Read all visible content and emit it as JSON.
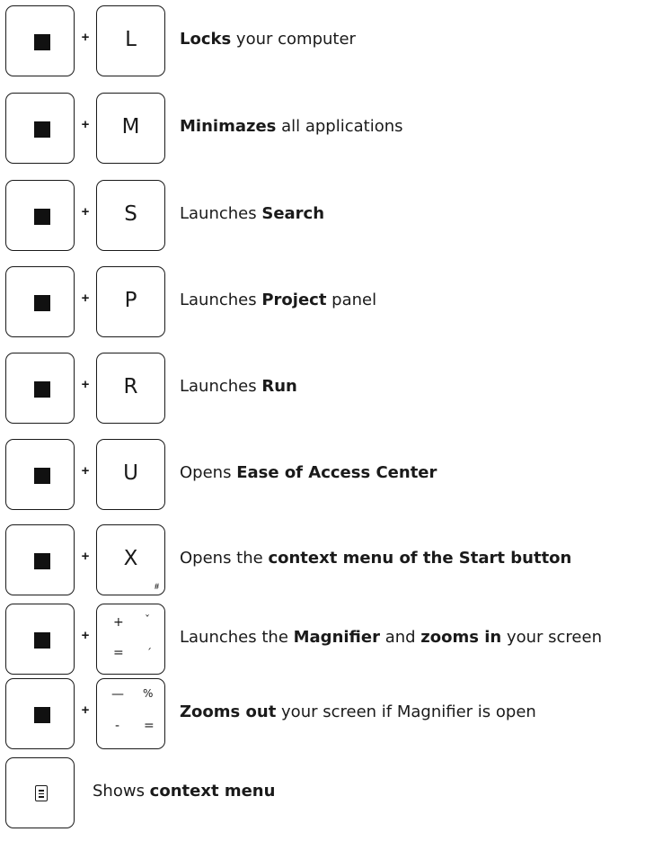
{
  "shortcuts": [
    {
      "modifier": "win-key",
      "plus": "+",
      "key": "L",
      "sub": "",
      "pre": "",
      "bold": "Locks",
      "mid": " your computer",
      "bold2": "",
      "post": ""
    },
    {
      "modifier": "win-key",
      "plus": "+",
      "key": "M",
      "sub": "",
      "pre": "",
      "bold": "Minimazes",
      "mid": " all applications",
      "bold2": "",
      "post": ""
    },
    {
      "modifier": "win-key",
      "plus": "+",
      "key": "S",
      "sub": "",
      "pre": "Launches ",
      "bold": "Search",
      "mid": "",
      "bold2": "",
      "post": ""
    },
    {
      "modifier": "win-key",
      "plus": "+",
      "key": "P",
      "sub": "",
      "pre": "Launches ",
      "bold": "Project",
      "mid": " panel",
      "bold2": "",
      "post": ""
    },
    {
      "modifier": "win-key",
      "plus": "+",
      "key": "R",
      "sub": "",
      "pre": "Launches ",
      "bold": "Run",
      "mid": "",
      "bold2": "",
      "post": ""
    },
    {
      "modifier": "win-key",
      "plus": "+",
      "key": "U",
      "sub": "",
      "pre": "Opens ",
      "bold": "Ease of Access Center",
      "mid": "",
      "bold2": "",
      "post": ""
    },
    {
      "modifier": "win-key",
      "plus": "+",
      "key": "X",
      "sub": "#",
      "pre": "Opens the ",
      "bold": "context menu of the Start button",
      "mid": "",
      "bold2": "",
      "post": ""
    },
    {
      "modifier": "win-key",
      "plus": "+",
      "key_glyphs": [
        "+",
        "ˇ",
        "=",
        "ˊ"
      ],
      "pre": "Launches the ",
      "bold": "Magnifier",
      "mid": " and ",
      "bold2": "zooms in",
      "post": " your screen"
    },
    {
      "modifier": "win-key",
      "plus": "+",
      "key_glyphs": [
        "—",
        "%",
        "-",
        "="
      ],
      "pre": "",
      "bold": "Zooms out",
      "mid": " your screen if Magnifier is open",
      "bold2": "",
      "post": ""
    }
  ],
  "context_key": {
    "icon": "menu-icon",
    "pre": "Shows ",
    "bold": "context menu"
  }
}
